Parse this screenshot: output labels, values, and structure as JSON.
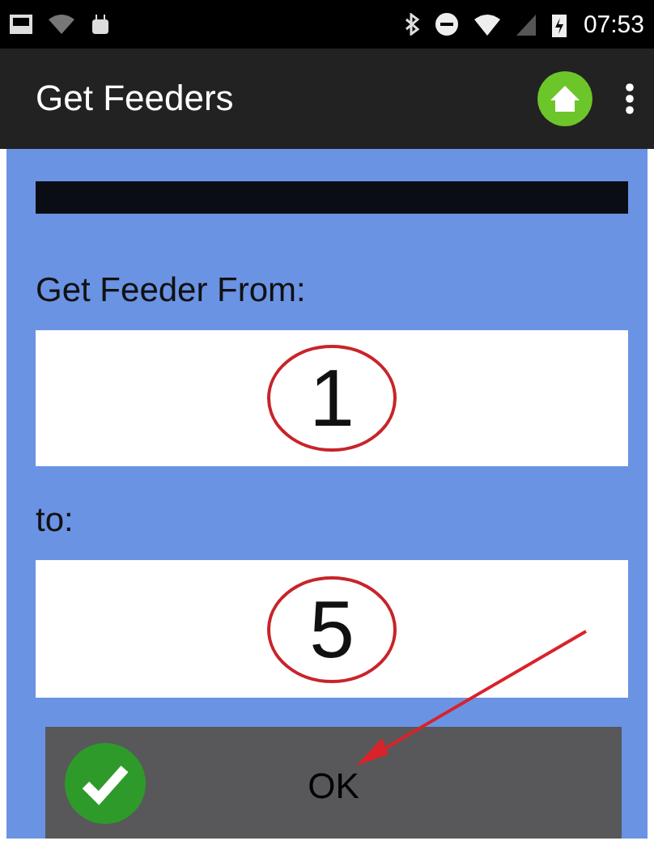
{
  "status_bar": {
    "time": "07:53"
  },
  "app_bar": {
    "title": "Get Feeders"
  },
  "form": {
    "from_label": "Get Feeder From:",
    "from_value": "1",
    "to_label": "to:",
    "to_value": "5"
  },
  "ok_button": {
    "label": "OK"
  }
}
